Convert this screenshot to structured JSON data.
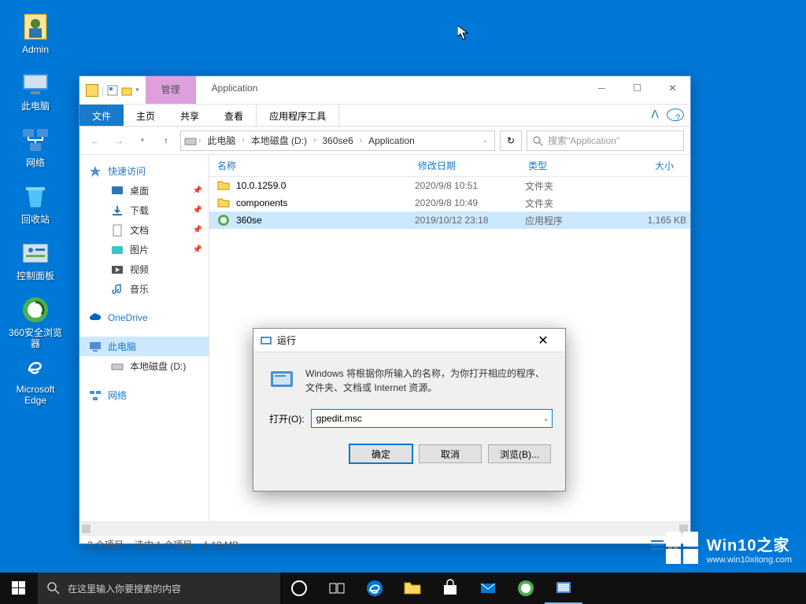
{
  "desktop": {
    "icons": [
      {
        "name": "admin-icon",
        "label": "Admin"
      },
      {
        "name": "this-pc-icon",
        "label": "此电脑"
      },
      {
        "name": "network-icon",
        "label": "网络"
      },
      {
        "name": "recycle-bin-icon",
        "label": "回收站"
      },
      {
        "name": "control-panel-icon",
        "label": "控制面板"
      },
      {
        "name": "360-browser-icon",
        "label": "360安全浏览器"
      },
      {
        "name": "edge-icon",
        "label": "Microsoft Edge"
      }
    ]
  },
  "explorer": {
    "ribbon_context_label": "管理",
    "window_title": "Application",
    "ribbon": {
      "file": "文件",
      "home": "主页",
      "share": "共享",
      "view": "查看",
      "app_tools": "应用程序工具"
    },
    "breadcrumbs": [
      "此电脑",
      "本地磁盘 (D:)",
      "360se6",
      "Application"
    ],
    "search_placeholder": "搜索\"Application\"",
    "nav": {
      "quick_access": "快速访问",
      "items": [
        {
          "label": "桌面",
          "icon": "desktop-icon",
          "pinned": true
        },
        {
          "label": "下载",
          "icon": "downloads-icon",
          "pinned": true
        },
        {
          "label": "文档",
          "icon": "documents-icon",
          "pinned": true
        },
        {
          "label": "图片",
          "icon": "pictures-icon",
          "pinned": true
        },
        {
          "label": "视频",
          "icon": "videos-icon",
          "pinned": false
        },
        {
          "label": "音乐",
          "icon": "music-icon",
          "pinned": false
        }
      ],
      "onedrive": "OneDrive",
      "this_pc": "此电脑",
      "local_disk": "本地磁盘 (D:)",
      "network": "网络"
    },
    "columns": {
      "name": "名称",
      "date": "修改日期",
      "type": "类型",
      "size": "大小"
    },
    "rows": [
      {
        "name": "10.0.1259.0",
        "date": "2020/9/8 10:51",
        "type": "文件夹",
        "size": "",
        "icon": "folder-icon",
        "selected": false
      },
      {
        "name": "components",
        "date": "2020/9/8 10:49",
        "type": "文件夹",
        "size": "",
        "icon": "folder-icon",
        "selected": false
      },
      {
        "name": "360se",
        "date": "2019/10/12 23:18",
        "type": "应用程序",
        "size": "1,165 KB",
        "icon": "app-icon",
        "selected": true
      }
    ],
    "status": {
      "count": "3 个项目",
      "selected": "选中 1 个项目",
      "size": "1.13 MB"
    }
  },
  "run": {
    "title": "运行",
    "message": "Windows 将根据你所输入的名称，为你打开相应的程序、文件夹、文档或 Internet 资源。",
    "open_label": "打开(O):",
    "value": "gpedit.msc",
    "ok": "确定",
    "cancel": "取消",
    "browse": "浏览(B)..."
  },
  "taskbar": {
    "search_placeholder": "在这里输入你要搜索的内容"
  },
  "watermark": {
    "brand": "Win10之家",
    "url": "www.win10xitong.com"
  }
}
